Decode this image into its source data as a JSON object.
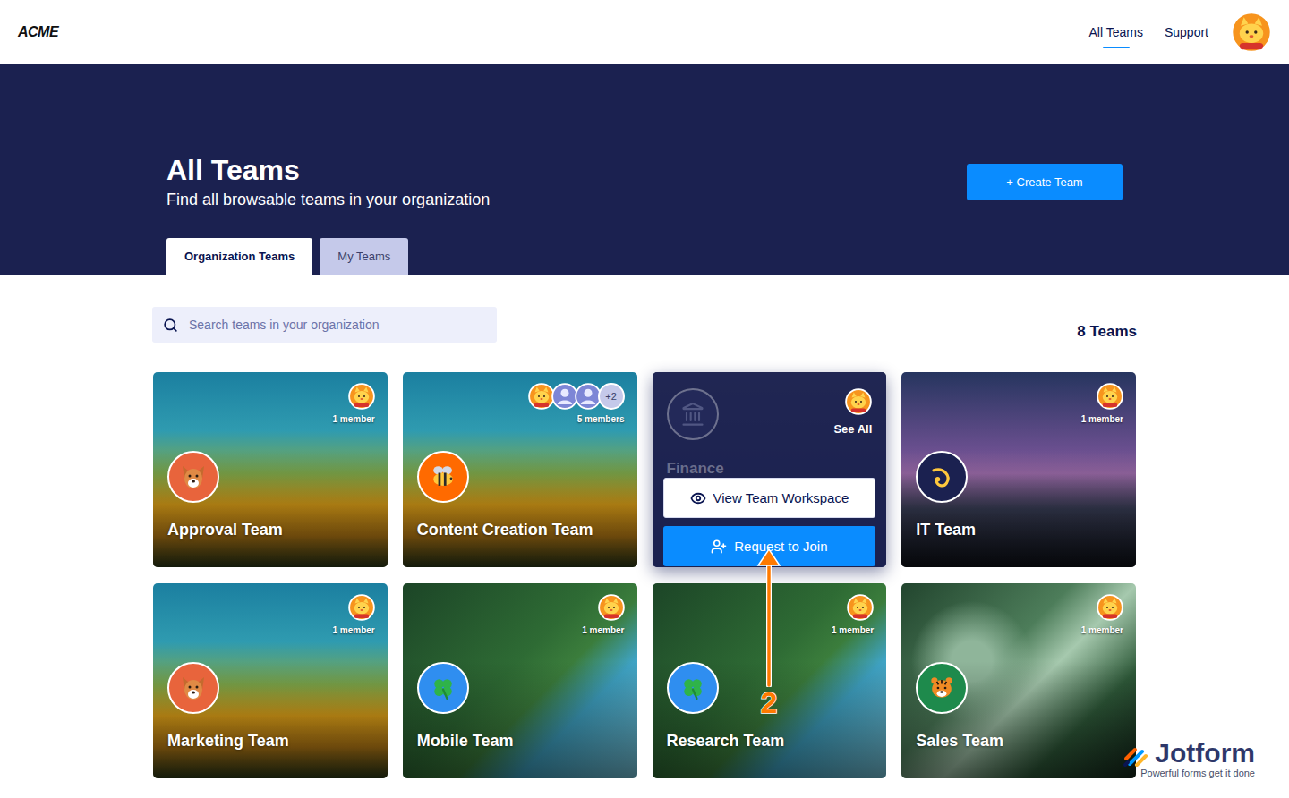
{
  "header": {
    "logo": "ACME",
    "nav": [
      {
        "label": "All Teams",
        "selected": true
      },
      {
        "label": "Support",
        "selected": false
      }
    ]
  },
  "hero": {
    "title": "All Teams",
    "subtitle": "Find all browsable teams in your organization",
    "create_button": "+ Create Team"
  },
  "tabs": [
    {
      "label": "Organization Teams",
      "selected": true
    },
    {
      "label": "My Teams",
      "selected": false
    }
  ],
  "search": {
    "placeholder": "Search teams in your organization"
  },
  "team_count": "8 Teams",
  "teams": [
    {
      "name": "Approval Team",
      "members": "1 member",
      "avatars": 1,
      "color": "#e8643c",
      "hovered": false
    },
    {
      "name": "Content Creation Team",
      "members": "5 members",
      "avatars": 3,
      "more": "+2",
      "color": "#ff6a00",
      "hovered": false
    },
    {
      "name": "Finance",
      "avatars": 1,
      "see_all": "See All",
      "actions": [
        "View Team Workspace",
        "Request to Join"
      ],
      "color": "#2b3266",
      "hovered": true
    },
    {
      "name": "IT Team",
      "members": "1 member",
      "avatars": 1,
      "color": "#1b2150",
      "hovered": false
    },
    {
      "name": "Marketing Team",
      "members": "1 member",
      "avatars": 1,
      "color": "#e8643c",
      "hovered": false
    },
    {
      "name": "Mobile Team",
      "members": "1 member",
      "avatars": 1,
      "color": "#2f8ef0",
      "hovered": false
    },
    {
      "name": "Research Team",
      "members": "1 member",
      "avatars": 1,
      "color": "#2f8ef0",
      "hovered": false
    },
    {
      "name": "Sales Team",
      "members": "1 member",
      "avatars": 1,
      "color": "#1e8a4c",
      "hovered": false
    }
  ],
  "annotation": {
    "label": "2"
  },
  "watermark": {
    "brand": "Jotform",
    "tagline": "Powerful forms get it done"
  }
}
